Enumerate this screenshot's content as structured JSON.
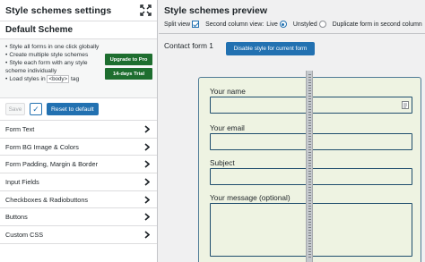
{
  "left": {
    "title": "Style schemes settings",
    "scheme_name": "Default Scheme",
    "promo": {
      "items": [
        "Style all forms in one click globally",
        "Create multiple style schemes",
        "Style each form with any style scheme individually"
      ],
      "load_prefix": "Load styles in ",
      "load_tag": "<body>",
      "load_suffix": " tag",
      "pro_button": "Upgrade to Pro",
      "trial_button": "14-days Trial"
    },
    "actions": {
      "save": "Save",
      "check": "✓",
      "reset": "Reset to default"
    },
    "sections": [
      "Form Text",
      "Form BG Image & Colors",
      "Form Padding, Margin & Border",
      "Input Fields",
      "Checkboxes & Radiobuttons",
      "Buttons",
      "Custom CSS"
    ]
  },
  "right": {
    "title": "Style schemes preview",
    "toggles": {
      "split_view": "Split view",
      "second_column": "Second column view:",
      "live": "Live",
      "unstyled": "Unstyled",
      "duplicate": "Duplicate form in second column"
    },
    "form_title": "Contact form 1",
    "disable_button": "Disable style for current form",
    "fields": [
      {
        "label": "Your name"
      },
      {
        "label": "Your email"
      },
      {
        "label": "Subject"
      },
      {
        "label": "Your message (optional)"
      }
    ]
  },
  "colors": {
    "accent": "#2271b1",
    "promo_green": "#1e6e2f",
    "form_bg": "#eef3e2",
    "form_border": "#4f7b96"
  }
}
